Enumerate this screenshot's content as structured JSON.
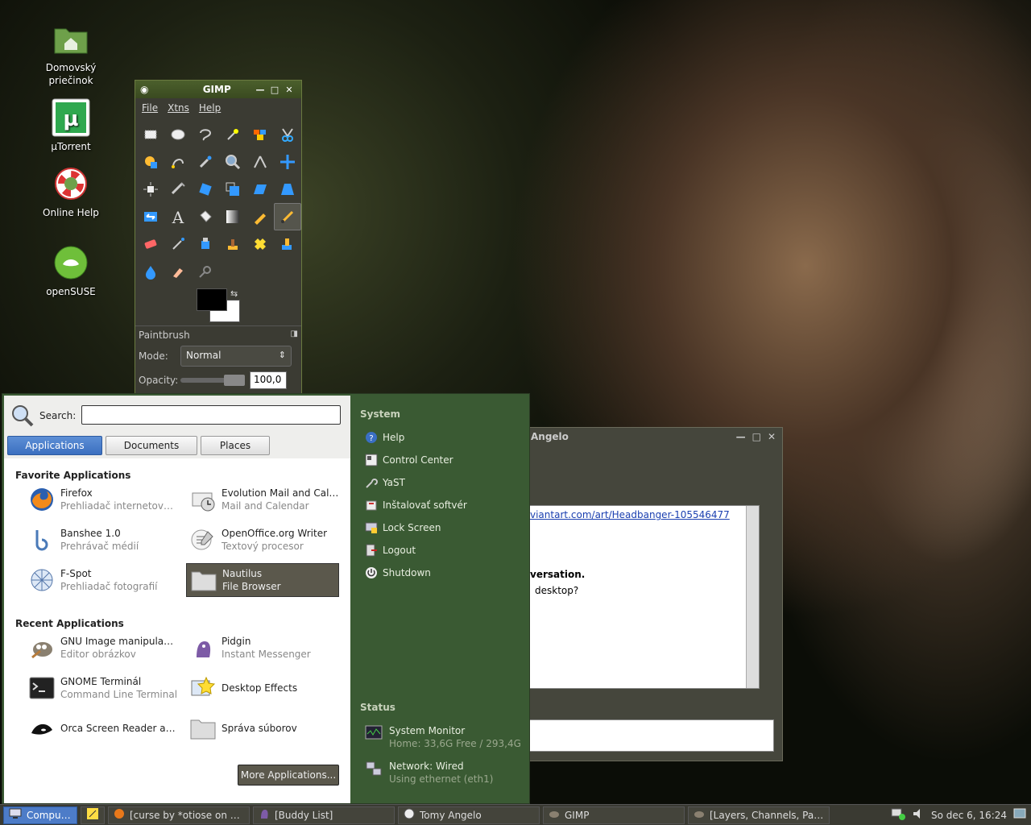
{
  "desktop": {
    "icons": [
      {
        "label_line1": "Domovský",
        "label_line2": "priečinok"
      },
      {
        "label": "µTorrent"
      },
      {
        "label": "Online Help"
      },
      {
        "label": "openSUSE"
      }
    ]
  },
  "gimp": {
    "title": "GIMP",
    "menu": [
      "File",
      "Xtns",
      "Help"
    ],
    "options_title": "Paintbrush",
    "mode_label": "Mode:",
    "mode_value": "Normal",
    "opacity_label": "Opacity:",
    "opacity_value": "100,0"
  },
  "pidgin": {
    "title": "Angelo",
    "link_text": "viantart.com/art/Headbanger-105546477",
    "line1": "versation.",
    "line2": "desktop?"
  },
  "menu": {
    "search_label": "Search:",
    "search_value": "",
    "tabs": [
      "Applications",
      "Documents",
      "Places"
    ],
    "favorites_title": "Favorite Applications",
    "favorites": [
      {
        "name": "Firefox",
        "desc": "Prehliadač internetový…"
      },
      {
        "name": "Evolution Mail and Cal…",
        "desc": "Mail and Calendar"
      },
      {
        "name": "Banshee 1.0",
        "desc": "Prehrávač médií"
      },
      {
        "name": "OpenOffice.org Writer",
        "desc": "Textový procesor"
      },
      {
        "name": "F-Spot",
        "desc": "Prehliadač fotografií"
      },
      {
        "name": "Nautilus",
        "desc": "File Browser"
      }
    ],
    "recent_title": "Recent Applications",
    "recent": [
      {
        "name": "GNU Image manipula…",
        "desc": "Editor obrázkov"
      },
      {
        "name": "Pidgin",
        "desc": "Instant Messenger"
      },
      {
        "name": "GNOME Terminál",
        "desc": "Command Line Terminal"
      },
      {
        "name": "Desktop Effects",
        "desc": ""
      },
      {
        "name": "Orca Screen Reader a…",
        "desc": ""
      },
      {
        "name": "Správa súborov",
        "desc": ""
      }
    ],
    "more_button": "More Applications...",
    "system_title": "System",
    "system_items": [
      "Help",
      "Control Center",
      "YaST",
      "Inštalovať softvér",
      "Lock Screen",
      "Logout",
      "Shutdown"
    ],
    "status_title": "Status",
    "status_items": [
      {
        "name": "System Monitor",
        "desc": "Home: 33,6G Free / 293,4G"
      },
      {
        "name": "Network: Wired",
        "desc": "Using ethernet (eth1)"
      }
    ]
  },
  "taskbar": {
    "computer": "Computer",
    "windows": [
      "[curse by *otiose on d…",
      "[Buddy List]",
      "Tomy Angelo",
      "GIMP",
      "[Layers, Channels, Pa…"
    ],
    "clock": "So dec  6, 16:24"
  }
}
